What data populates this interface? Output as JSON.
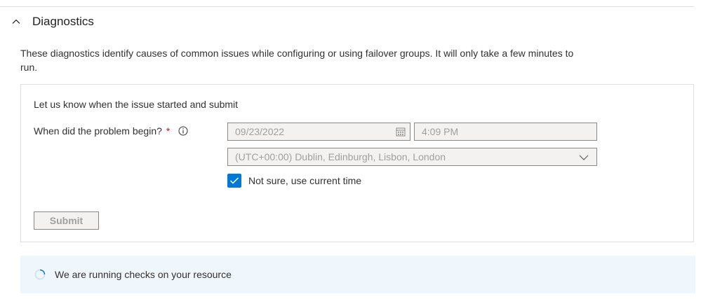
{
  "section": {
    "title": "Diagnostics",
    "description": "These diagnostics identify causes of common issues while configuring or using failover groups. It will only take a few minutes to run."
  },
  "form": {
    "intro": "Let us know when the issue started and submit",
    "label": "When did the problem begin?",
    "required_mark": "*",
    "date_value": "09/23/2022",
    "time_value": "4:09 PM",
    "timezone_value": "(UTC+00:00) Dublin, Edinburgh, Lisbon, London",
    "checkbox_label": "Not sure, use current time",
    "checkbox_checked": true,
    "submit_label": "Submit"
  },
  "status": {
    "message": "We are running checks on your resource"
  },
  "colors": {
    "accent": "#0078d4",
    "required": "#a4262c",
    "status_bg": "#eff6fc"
  },
  "icons": [
    "chevron-up-icon",
    "info-icon",
    "calendar-icon",
    "chevron-down-icon",
    "checkmark-icon",
    "spinner-icon"
  ]
}
